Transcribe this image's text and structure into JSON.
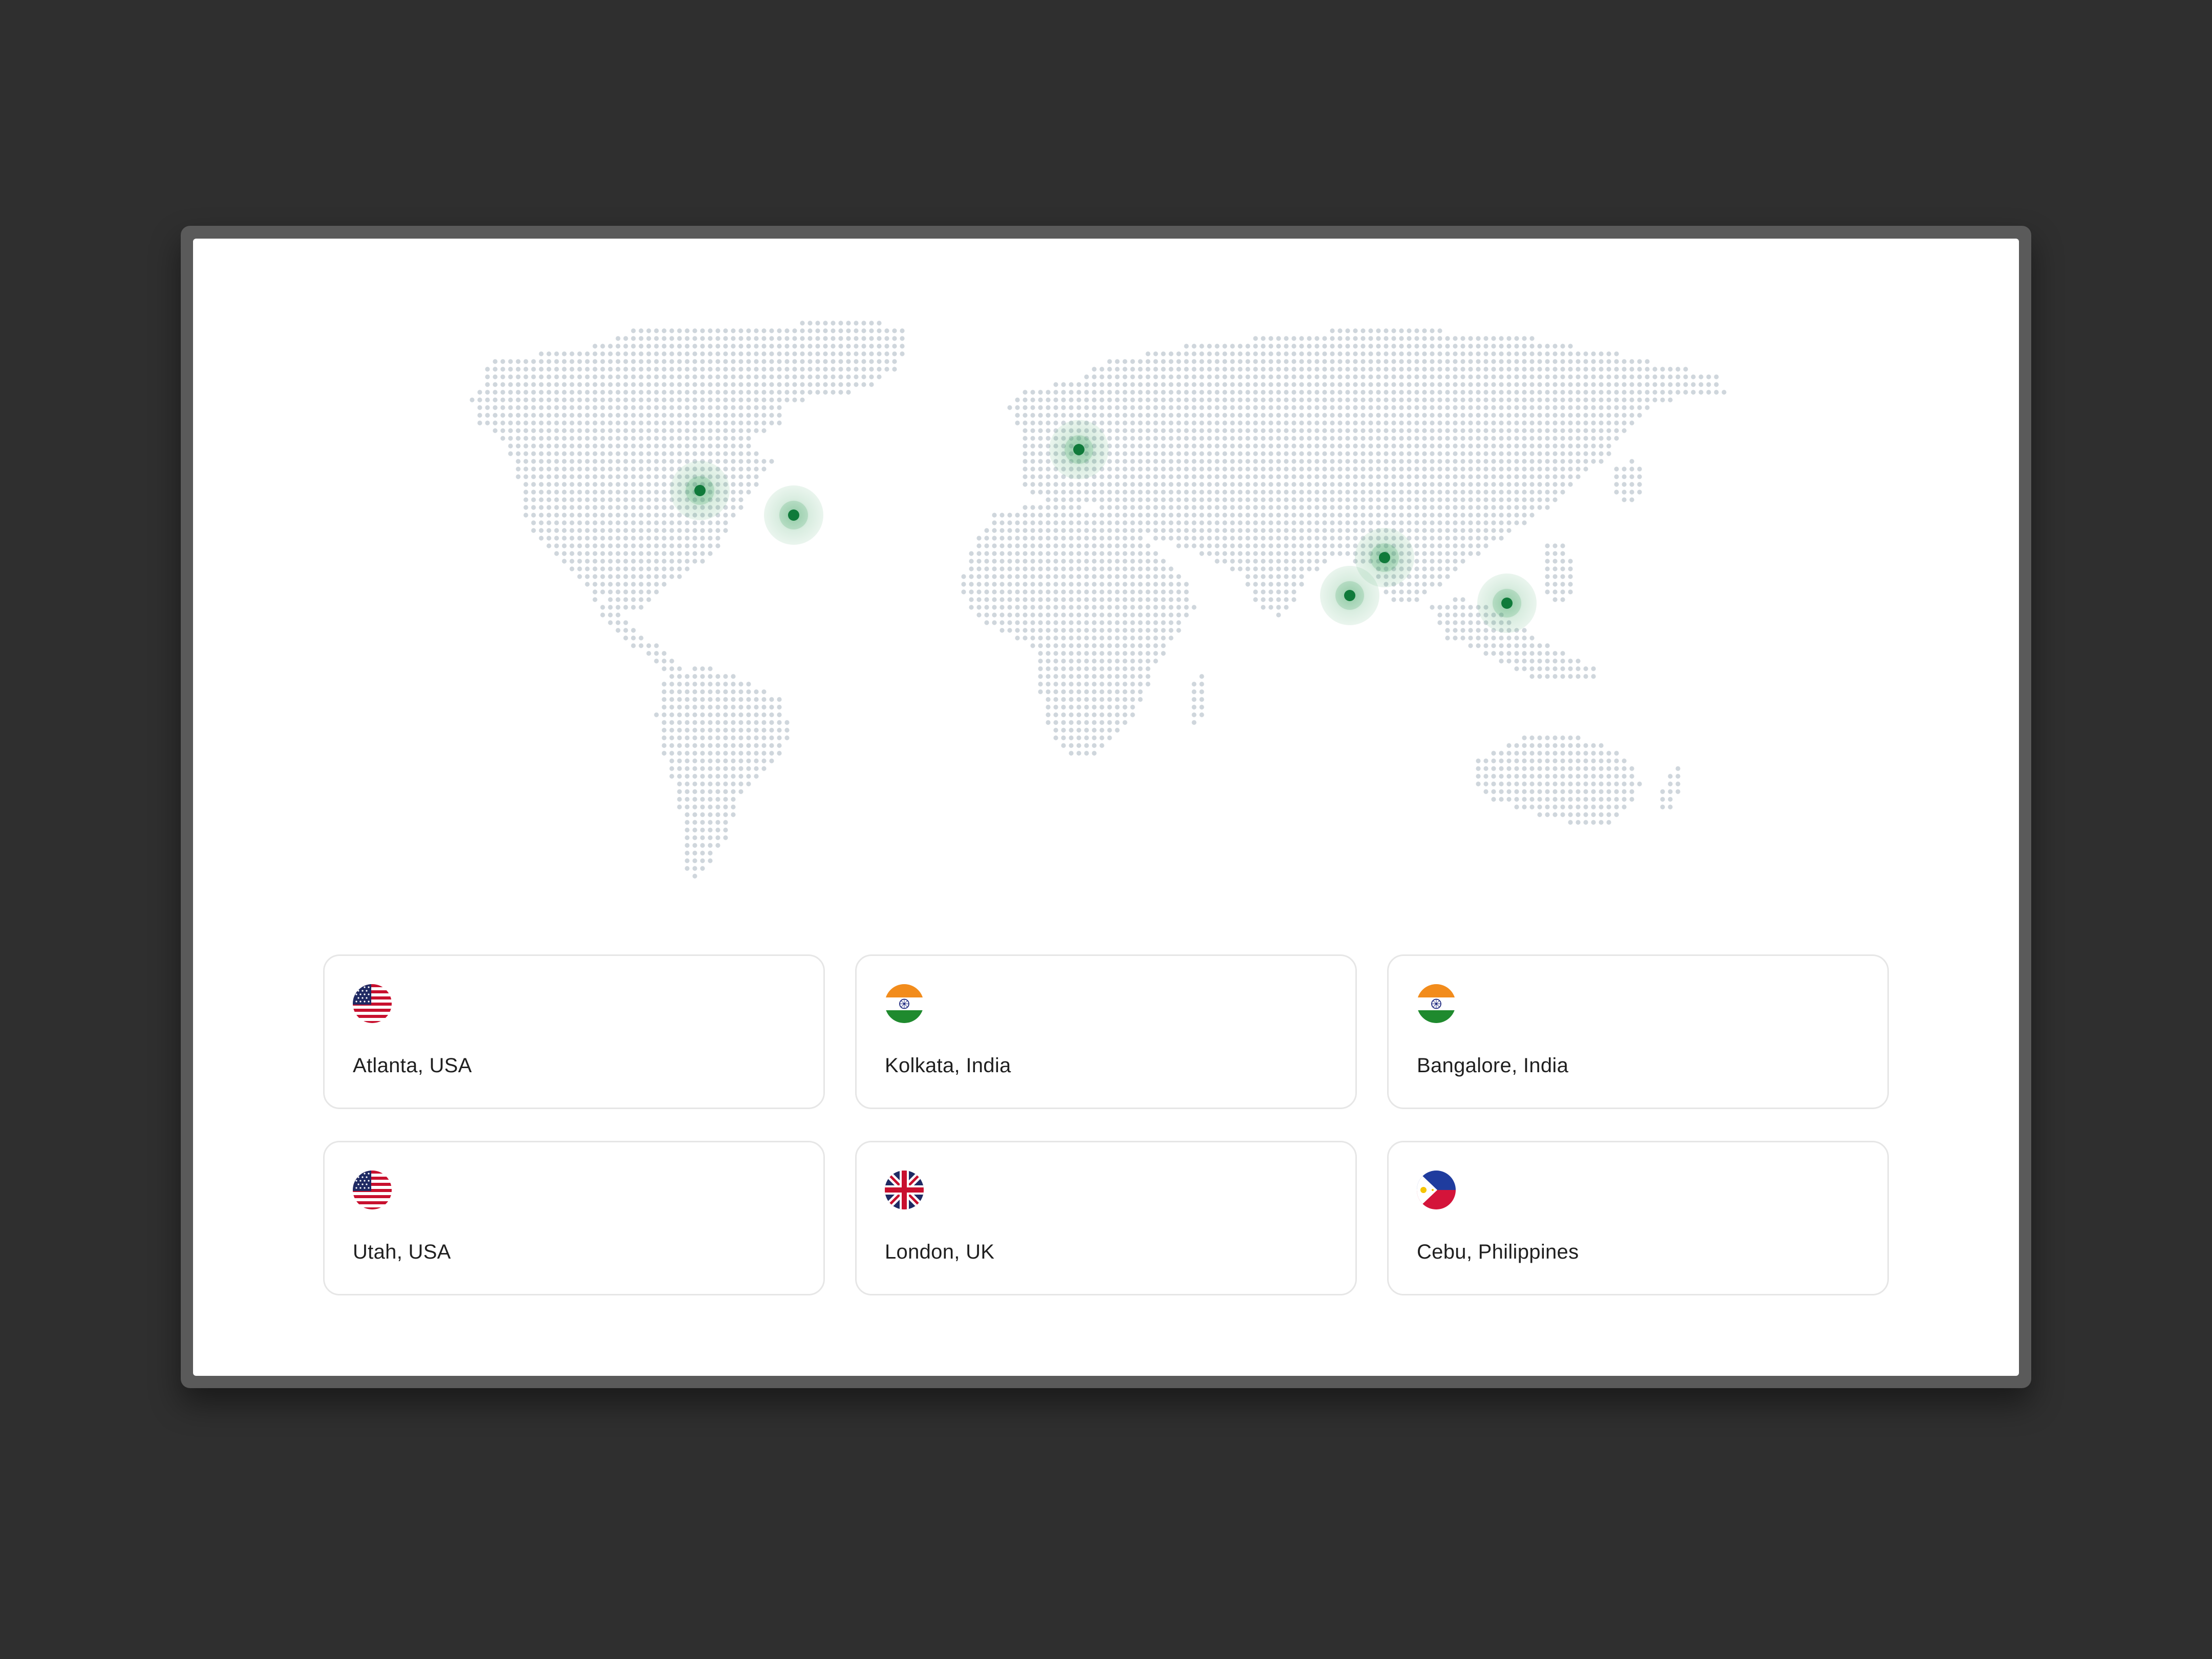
{
  "colors": {
    "background": "#2f2f2f",
    "screen": "#ffffff",
    "map_dot": "#cfd6dc",
    "marker": "#0f7a3a",
    "marker_halo": "#2e9b55",
    "card_border": "#e6e6e6",
    "text": "#1f1f1f"
  },
  "map": {
    "markers": [
      {
        "name": "map-marker-utah",
        "icon": "location-pin-icon"
      },
      {
        "name": "map-marker-atlanta",
        "icon": "location-pin-icon"
      },
      {
        "name": "map-marker-london",
        "icon": "location-pin-icon"
      },
      {
        "name": "map-marker-kolkata",
        "icon": "location-pin-icon"
      },
      {
        "name": "map-marker-bangalore",
        "icon": "location-pin-icon"
      },
      {
        "name": "map-marker-cebu",
        "icon": "location-pin-icon"
      }
    ]
  },
  "locations": [
    {
      "city": "Atlanta, USA",
      "flag": "us-flag-icon"
    },
    {
      "city": "Kolkata, India",
      "flag": "india-flag-icon"
    },
    {
      "city": "Bangalore, India",
      "flag": "india-flag-icon"
    },
    {
      "city": "Utah, USA",
      "flag": "us-flag-icon"
    },
    {
      "city": "London, UK",
      "flag": "uk-flag-icon"
    },
    {
      "city": "Cebu, Philippines",
      "flag": "philippines-flag-icon"
    }
  ]
}
